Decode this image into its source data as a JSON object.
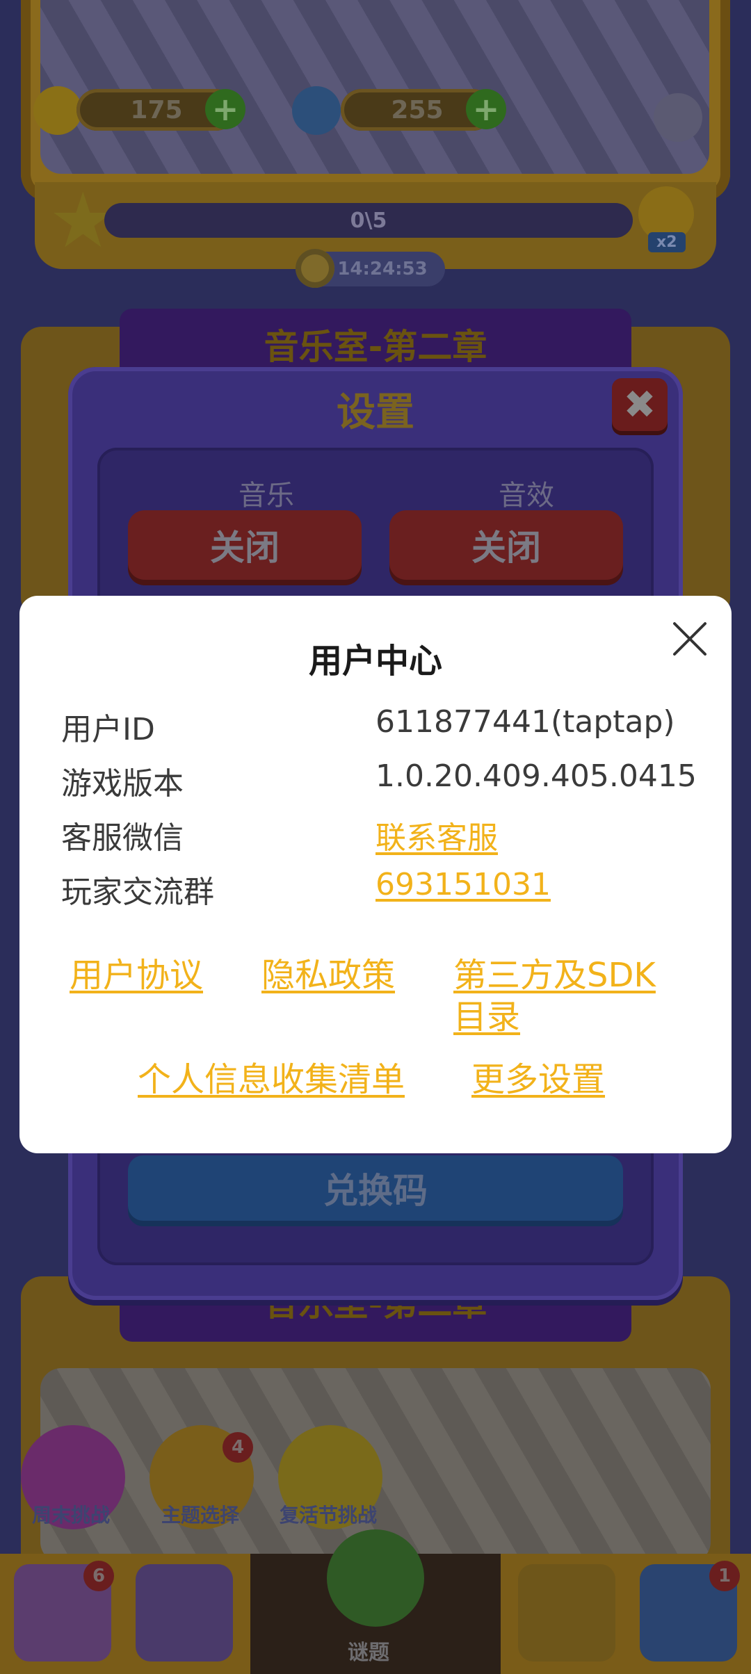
{
  "game": {
    "currency_1": "175",
    "currency_2": "255",
    "star_progress": "0\\5",
    "multiplier": "x2",
    "timer": "14:24:53",
    "chapter_title": "音乐室-第二章",
    "bottom_buttons": [
      "周末挑战",
      "主题选择",
      "复活节挑战"
    ],
    "theme_badge": "4",
    "nav_badge_left": "6",
    "nav_badge_right": "1",
    "nav_center_label": "谜题"
  },
  "settings": {
    "title": "设置",
    "music_label": "音乐",
    "sfx_label": "音效",
    "music_button": "关闭",
    "sfx_button": "关闭",
    "redeem_button": "兑换码"
  },
  "user_center": {
    "title": "用户中心",
    "rows": [
      {
        "label": "用户ID",
        "value": "611877441(taptap)"
      },
      {
        "label": "游戏版本",
        "value": "1.0.20.409.405.0415"
      },
      {
        "label": "客服微信",
        "value": "联系客服"
      },
      {
        "label": "玩家交流群",
        "value": "693151031"
      }
    ],
    "links": {
      "user_agreement": "用户协议",
      "privacy_policy": "隐私政策",
      "third_party_sdk_line1": "第三方及SDK",
      "third_party_sdk_line2": "目录",
      "personal_info_list": "个人信息收集清单",
      "more_settings": "更多设置"
    }
  },
  "colors": {
    "link": "#f2b21a",
    "modal_bg": "#ffffff",
    "text": "#3a3a3a"
  }
}
